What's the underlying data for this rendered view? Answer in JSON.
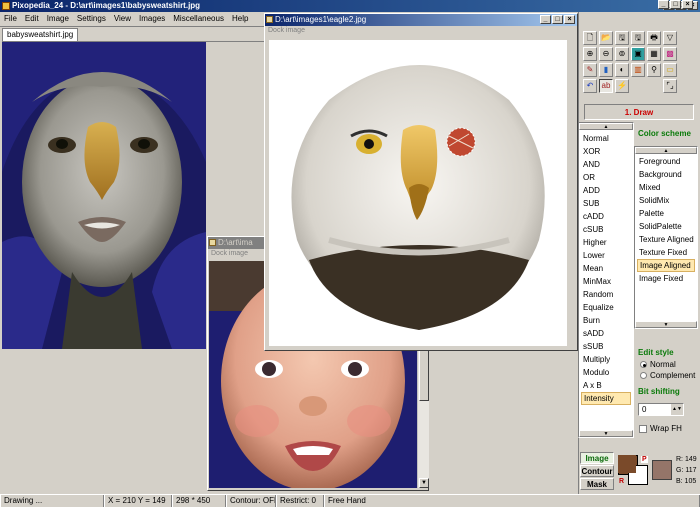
{
  "app": {
    "title": "Pixopedia_24 - D:\\art\\images1\\babysweatshirt.jpg"
  },
  "menu": [
    "File",
    "Edit",
    "Image",
    "Settings",
    "View",
    "Images",
    "Miscellaneous",
    "Help"
  ],
  "tabs": {
    "active": "babysweatshirt.jpg"
  },
  "windows": {
    "eagle": {
      "title": "D:\\art\\images1\\eagle2.jpg",
      "dock_label": "Dock image"
    },
    "baby2": {
      "title": "D:\\art\\ima",
      "dock_label": "Dock image"
    }
  },
  "tools": {
    "icons": [
      "new-icon",
      "open-icon",
      "save-icon",
      "save-as-icon",
      "print-icon",
      "funnel-icon",
      "zoom-in-icon",
      "zoom-out-icon",
      "zoom-fit-icon",
      "zoom-actual-icon",
      "grid-icon",
      "pattern-icon",
      "brush-icon",
      "histogram-icon",
      "contrast-icon",
      "palette-icon",
      "eyedropper-icon",
      "rectangle-select-icon",
      "undo-icon",
      "text-icon",
      "wand-icon",
      "",
      "",
      "crop-corners-icon"
    ],
    "draw_label": "1.  Draw"
  },
  "blend_modes": {
    "items": [
      "Normal",
      "XOR",
      "AND",
      "OR",
      "ADD",
      "SUB",
      "cADD",
      "cSUB",
      "Higher",
      "Lower",
      "Mean",
      "MinMax",
      "Random",
      "Equalize",
      "Burn",
      "sADD",
      "sSUB",
      "Multiply",
      "Modulo",
      "A x B",
      "Intensity"
    ],
    "selected": "Intensity"
  },
  "color_scheme": {
    "heading": "Color scheme",
    "items": [
      "Foreground",
      "Background",
      "Mixed",
      "SolidMix",
      "Palette",
      "SolidPalette",
      "Texture Aligned",
      "Texture Fixed",
      "Image Aligned",
      "Image Fixed"
    ],
    "selected": "Image Aligned"
  },
  "edit_style": {
    "heading": "Edit style",
    "options": [
      "Normal",
      "Complement"
    ],
    "selected": "Normal"
  },
  "bit_shifting": {
    "heading": "Bit shifting",
    "value": "0",
    "wrap_label": "Wrap FH"
  },
  "modes": {
    "image": "Image",
    "contour": "Contour",
    "mask": "Mask"
  },
  "colors": {
    "primary_swatch": "#7a4a2a",
    "secondary_swatch": "#ffffff",
    "picked_swatch": "#957569",
    "p_label": "P",
    "r_label": "R",
    "r": "R: 149",
    "g": "G: 117",
    "b": "B: 105"
  },
  "status": {
    "state": "Drawing ...",
    "coords": "X = 210 Y = 149",
    "size": "298 * 450",
    "contour": "Contour: OFF",
    "restrict": "Restrict: 0",
    "tool": "Free Hand"
  }
}
